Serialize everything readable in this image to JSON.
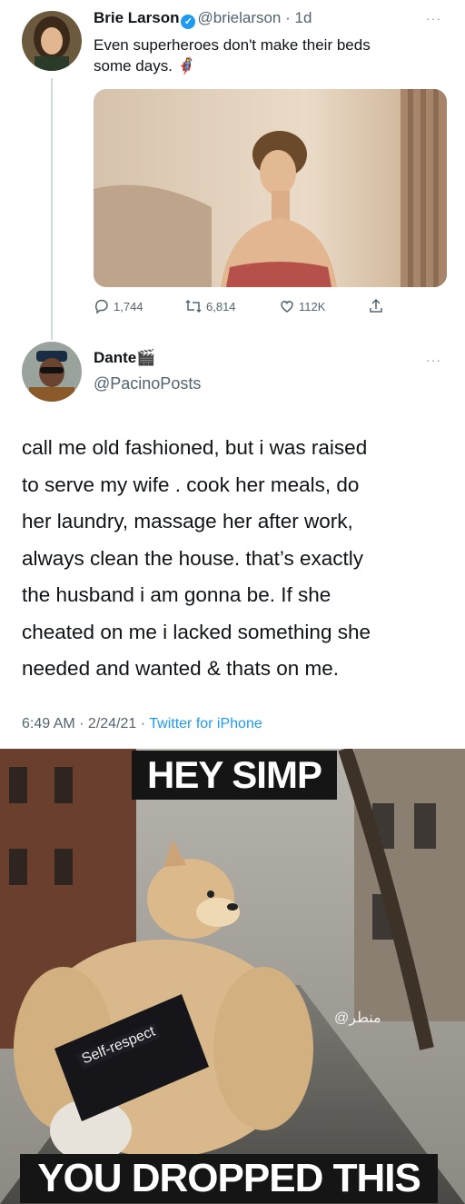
{
  "tweet1": {
    "name": "Brie Larson",
    "handle": "@brielarson",
    "time": "1d",
    "text_line1": "Even superheroes don't make their beds",
    "text_line2": "some days.",
    "emoji": "🦸‍♀️",
    "replies": "1,744",
    "retweets": "6,814",
    "likes": "112K",
    "verified_glyph": "✓",
    "more_glyph": "···"
  },
  "tweet2": {
    "name": "Dante",
    "name_emoji": "🎬",
    "handle": "@PacinoPosts",
    "more_glyph": "···",
    "lines": [
      "call me old fashioned, but i was raised",
      "to serve my wife . cook her meals, do",
      "her laundry, massage her after work,",
      "always clean the house. that’s exactly",
      "the husband i am gonna be. If she",
      "cheated on me i lacked something she",
      "needed and wanted & thats on me."
    ],
    "time": "6:49 AM",
    "date": "2/24/21",
    "source": "Twitter for iPhone"
  },
  "meme": {
    "top_caption": "HEY SIMP",
    "bottom_caption": "YOU DROPPED THIS",
    "card_label": "Self-respect",
    "watermark": "@منطر"
  },
  "colors": {
    "text": "#0f1419",
    "secondary": "#536471",
    "link": "#1d9bf0",
    "thread_line": "#cfd9de"
  }
}
